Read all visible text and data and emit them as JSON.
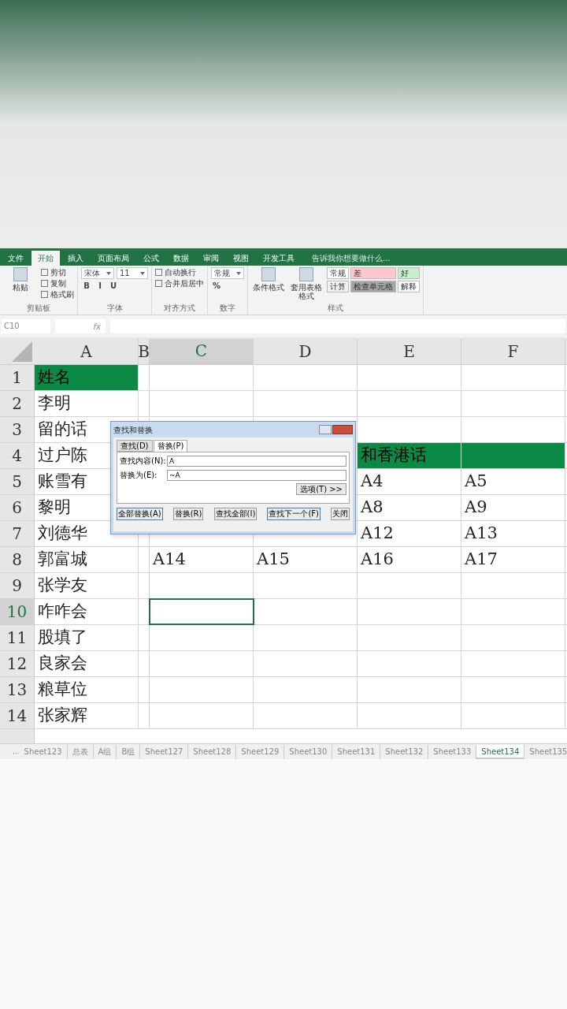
{
  "ribbon_tabs": [
    {
      "label": "文件",
      "selected": false
    },
    {
      "label": "开始",
      "selected": true
    },
    {
      "label": "插入",
      "selected": false
    },
    {
      "label": "页面布局",
      "selected": false
    },
    {
      "label": "公式",
      "selected": false
    },
    {
      "label": "数据",
      "selected": false
    },
    {
      "label": "审阅",
      "selected": false
    },
    {
      "label": "视图",
      "selected": false
    },
    {
      "label": "开发工具",
      "selected": false
    }
  ],
  "tell_me": "告诉我你想要做什么...",
  "ribbon_groups": [
    {
      "title": "剪贴板",
      "big": [
        "粘贴"
      ],
      "rows": [
        [
          {
            "kind": "button",
            "label": "剪切"
          }
        ],
        [
          {
            "kind": "button",
            "label": "复制"
          }
        ],
        [
          {
            "kind": "button",
            "label": "格式刷"
          }
        ]
      ]
    },
    {
      "title": "字体",
      "rows": [
        [
          {
            "kind": "field",
            "label": "宋体"
          },
          {
            "kind": "field",
            "label": "11"
          }
        ],
        [
          {
            "kind": "char",
            "label": "B"
          },
          {
            "kind": "char",
            "label": "I"
          },
          {
            "kind": "char",
            "label": "U"
          }
        ]
      ]
    },
    {
      "title": "对齐方式",
      "rows": [
        [
          {
            "kind": "button",
            "label": "自动换行"
          }
        ],
        [
          {
            "kind": "button",
            "label": "合并后居中"
          }
        ]
      ]
    },
    {
      "title": "数字",
      "rows": [
        [
          {
            "kind": "field",
            "label": "常规"
          }
        ],
        [
          {
            "kind": "char",
            "label": "%"
          }
        ]
      ]
    },
    {
      "title": "样式",
      "big": [
        "条件格式",
        "套用表格格式"
      ],
      "rows": [
        [
          {
            "kind": "style",
            "label": "常规",
            "color": "#ffffff"
          },
          {
            "kind": "style",
            "label": "差",
            "color": "#ffc7ce"
          },
          {
            "kind": "style",
            "label": "好",
            "color": "#c6efce"
          }
        ],
        [
          {
            "kind": "style",
            "label": "计算",
            "color": "#f2f2f2"
          },
          {
            "kind": "style",
            "label": "检查单元格",
            "color": "#a5a5a5"
          },
          {
            "kind": "style",
            "label": "解释",
            "color": "#ffffff"
          }
        ]
      ]
    }
  ],
  "name_box": "C10",
  "fx": "fx",
  "columns": [
    {
      "label": "A",
      "selected": false
    },
    {
      "label": "B",
      "selected": false
    },
    {
      "label": "C",
      "selected": true
    },
    {
      "label": "D",
      "selected": false
    },
    {
      "label": "E",
      "selected": false
    },
    {
      "label": "F",
      "selected": false
    }
  ],
  "rows": [
    {
      "number": "1",
      "selected": false,
      "cells": [
        {
          "text": "姓名",
          "highlighted": true
        },
        {},
        {},
        {},
        {},
        {}
      ]
    },
    {
      "number": "2",
      "selected": false,
      "cells": [
        {
          "text": "李明",
          "highlighted": false
        },
        {},
        {},
        {},
        {},
        {}
      ]
    },
    {
      "number": "3",
      "selected": false,
      "cells": [
        {
          "text": "留的话",
          "highlighted": false
        },
        {},
        {},
        {},
        {},
        {}
      ]
    },
    {
      "number": "4",
      "selected": false,
      "cells": [
        {
          "text": "过户陈",
          "highlighted": false
        },
        {},
        {},
        {},
        {
          "text": "和香港话",
          "highlighted": true
        },
        {
          "highlighted": true
        }
      ]
    },
    {
      "number": "5",
      "selected": false,
      "cells": [
        {
          "text": "账雪有",
          "highlighted": false
        },
        {},
        {},
        {},
        {
          "text": "A4",
          "highlighted": false
        },
        {
          "text": "A5",
          "highlighted": false
        }
      ]
    },
    {
      "number": "6",
      "selected": false,
      "cells": [
        {
          "text": "黎明",
          "highlighted": false
        },
        {},
        {},
        {},
        {
          "text": "A8",
          "highlighted": false
        },
        {
          "text": "A9",
          "highlighted": false
        }
      ]
    },
    {
      "number": "7",
      "selected": false,
      "cells": [
        {
          "text": "刘德华",
          "highlighted": false
        },
        {},
        {},
        {},
        {
          "text": "A12",
          "highlighted": false
        },
        {
          "text": "A13",
          "highlighted": false
        }
      ]
    },
    {
      "number": "8",
      "selected": false,
      "cells": [
        {
          "text": "郭富城",
          "highlighted": false
        },
        {},
        {
          "text": "A14",
          "highlighted": false
        },
        {
          "text": "A15",
          "highlighted": false
        },
        {
          "text": "A16",
          "highlighted": false
        },
        {
          "text": "A17",
          "highlighted": false
        }
      ]
    },
    {
      "number": "9",
      "selected": false,
      "cells": [
        {
          "text": "张学友",
          "highlighted": false
        },
        {},
        {},
        {},
        {},
        {}
      ]
    },
    {
      "number": "10",
      "selected": true,
      "cells": [
        {
          "text": "咋咋会",
          "highlighted": false
        },
        {},
        {
          "active": true
        },
        {},
        {},
        {}
      ]
    },
    {
      "number": "11",
      "selected": false,
      "cells": [
        {
          "text": "股填了",
          "highlighted": false
        },
        {},
        {},
        {},
        {},
        {}
      ]
    },
    {
      "number": "12",
      "selected": false,
      "cells": [
        {
          "text": "良家会",
          "highlighted": false
        },
        {},
        {},
        {},
        {},
        {}
      ]
    },
    {
      "number": "13",
      "selected": false,
      "cells": [
        {
          "text": "粮草位",
          "highlighted": false
        },
        {},
        {},
        {},
        {},
        {}
      ]
    },
    {
      "number": "14",
      "selected": false,
      "cells": [
        {
          "text": "张家辉",
          "highlighted": false
        },
        {},
        {},
        {},
        {},
        {}
      ]
    }
  ],
  "sheet_nav_more": "...",
  "sheet_tabs": [
    {
      "label": "Sheet123",
      "selected": false
    },
    {
      "label": "总表",
      "selected": false
    },
    {
      "label": "A组",
      "selected": false
    },
    {
      "label": "B组",
      "selected": false
    },
    {
      "label": "Sheet127",
      "selected": false
    },
    {
      "label": "Sheet128",
      "selected": false
    },
    {
      "label": "Sheet129",
      "selected": false
    },
    {
      "label": "Sheet130",
      "selected": false
    },
    {
      "label": "Sheet131",
      "selected": false
    },
    {
      "label": "Sheet132",
      "selected": false
    },
    {
      "label": "Sheet133",
      "selected": false
    },
    {
      "label": "Sheet134",
      "selected": true
    },
    {
      "label": "Sheet135",
      "selected": false
    }
  ],
  "dialog": {
    "title": "查找和替换",
    "tabs": [
      {
        "label": "查找(D)",
        "selected": false
      },
      {
        "label": "替换(P)",
        "selected": true
      }
    ],
    "fields": [
      {
        "label": "查找内容(N):",
        "value": "A"
      },
      {
        "label": "替换为(E):",
        "value": "~A"
      }
    ],
    "options_button": "选项(T) >>",
    "buttons": [
      "全部替换(A)",
      "替换(R)",
      "查找全部(I)",
      "查找下一个(F)",
      "关闭"
    ]
  }
}
